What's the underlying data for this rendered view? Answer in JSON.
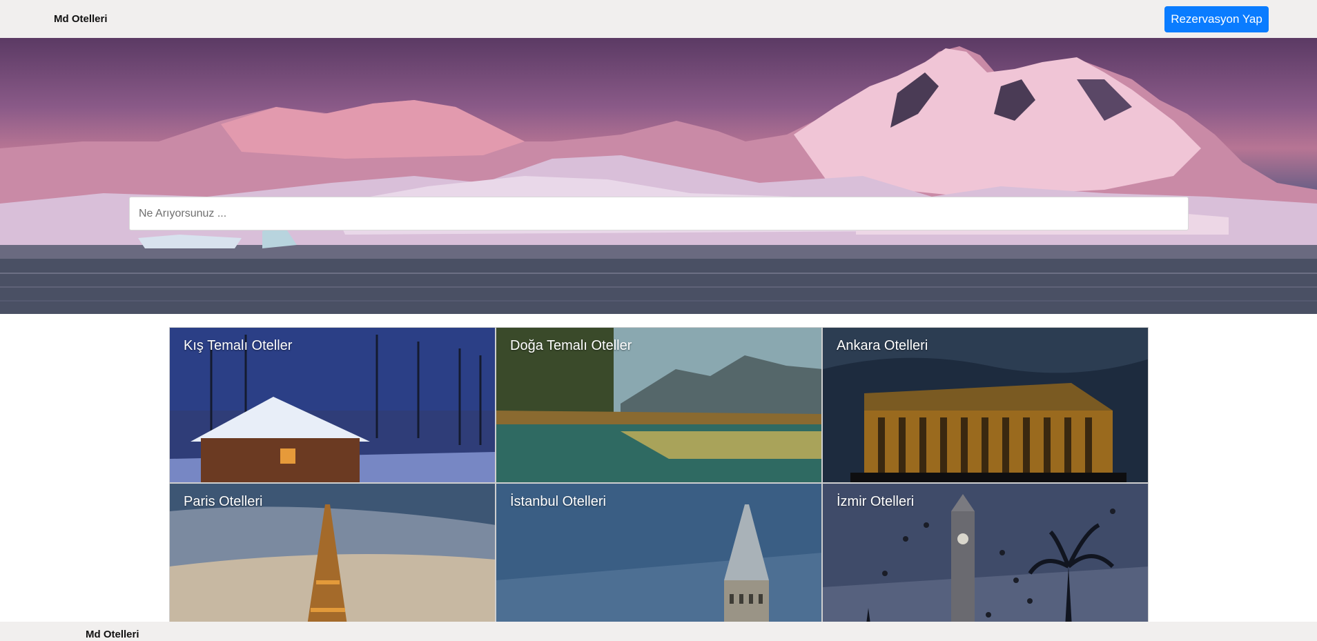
{
  "navbar": {
    "brand": "Md Otelleri",
    "reserve_button": "Rezervasyon Yap"
  },
  "hero": {
    "search_placeholder": "Ne Arıyorsunuz ..."
  },
  "categories": [
    {
      "title": "Kış Temalı Oteller"
    },
    {
      "title": "Doğa Temalı Oteller"
    },
    {
      "title": "Ankara Otelleri"
    },
    {
      "title": "Paris Otelleri"
    },
    {
      "title": "İstanbul Otelleri"
    },
    {
      "title": "İzmir Otelleri"
    }
  ],
  "footer": {
    "brand": "Md Otelleri"
  },
  "colors": {
    "accent": "#0a7cff",
    "navbar_bg": "#f1efee"
  }
}
